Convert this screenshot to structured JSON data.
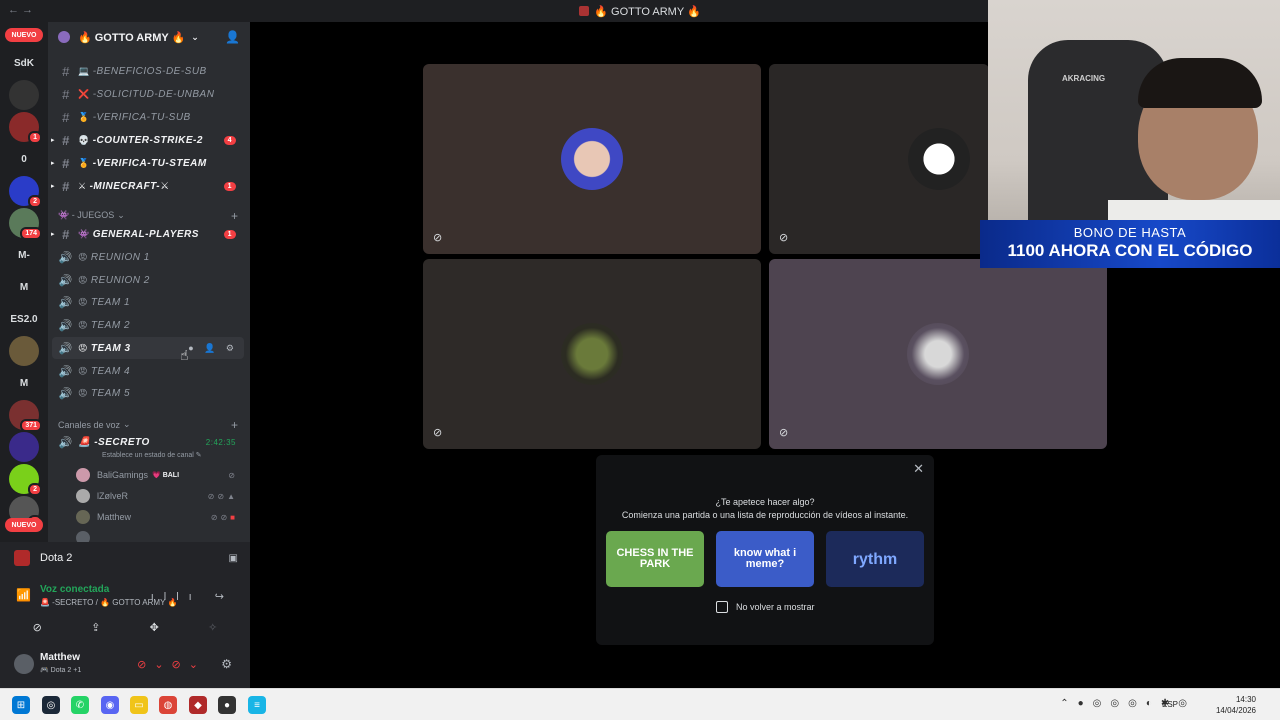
{
  "titlebar": {
    "title": "🔥 GOTTO ARMY 🔥",
    "nav": "←  →"
  },
  "rail": {
    "nuevo_top": "NUEVO",
    "nuevo_bottom": "NUEVO",
    "servers": [
      {
        "label": "SdK",
        "badge": ""
      },
      {
        "label": "",
        "badge": ""
      },
      {
        "label": "",
        "badge": "1"
      },
      {
        "label": "0",
        "badge": ""
      },
      {
        "label": "",
        "badge": "2"
      },
      {
        "label": "",
        "badge": "174"
      },
      {
        "label": "M-",
        "badge": ""
      },
      {
        "label": "M",
        "badge": ""
      },
      {
        "label": "ES2.0",
        "badge": ""
      },
      {
        "label": "",
        "badge": ""
      },
      {
        "label": "M",
        "badge": ""
      },
      {
        "label": "",
        "badge": "371"
      },
      {
        "label": "",
        "badge": ""
      },
      {
        "label": "",
        "badge": "2"
      },
      {
        "label": "",
        "badge": "2"
      }
    ]
  },
  "server": {
    "name": "🔥 GOTTO ARMY 🔥"
  },
  "channels": [
    {
      "icon": "hash",
      "emoji": "💻",
      "name": "-BENEFICIOS-DE-SUB",
      "unread": false,
      "badge": ""
    },
    {
      "icon": "hash",
      "emoji": "❌",
      "name": "-SOLICITUD-DE-UNBAN",
      "unread": false,
      "badge": ""
    },
    {
      "icon": "hash",
      "emoji": "🏅",
      "name": "-VERIFICA-TU-SUB",
      "unread": false,
      "badge": ""
    },
    {
      "icon": "hash",
      "emoji": "💀",
      "name": "-COUNTER-STRIKE-2",
      "unread": true,
      "badge": "4"
    },
    {
      "icon": "hash",
      "emoji": "🏅",
      "name": "-VERIFICA-TU-STEAM",
      "unread": true,
      "badge": ""
    },
    {
      "icon": "hash",
      "emoji": "⚔",
      "name": "-MINECRAFT-⚔",
      "unread": true,
      "badge": "1"
    }
  ],
  "category_juegos": "👾 - JUEGOS",
  "games": [
    {
      "icon": "hash",
      "emoji": "👾",
      "name": "GENERAL-PLAYERS",
      "unread": true,
      "badge": "1"
    },
    {
      "icon": "speaker",
      "emoji": "😡",
      "name": "REUNION 1",
      "unread": false,
      "badge": ""
    },
    {
      "icon": "speaker",
      "emoji": "😡",
      "name": "REUNION 2",
      "unread": false,
      "badge": ""
    },
    {
      "icon": "speaker",
      "emoji": "😡",
      "name": "TEAM 1",
      "unread": false,
      "badge": ""
    },
    {
      "icon": "speaker",
      "emoji": "😡",
      "name": "TEAM 2",
      "unread": false,
      "badge": ""
    },
    {
      "icon": "speaker",
      "emoji": "😡",
      "name": "TEAM 3",
      "unread": false,
      "badge": ""
    },
    {
      "icon": "speaker",
      "emoji": "😡",
      "name": "TEAM 4",
      "unread": false,
      "badge": ""
    },
    {
      "icon": "speaker",
      "emoji": "😡",
      "name": "TEAM 5",
      "unread": false,
      "badge": ""
    }
  ],
  "category_voice": "Canales de voz",
  "active_voice": {
    "name": "🚨 -SECRETO",
    "time": "2:42:35",
    "status": "Establece un estado de canal ✎"
  },
  "voice_users": [
    {
      "name": "BaliGamings",
      "tag": "💗 BALI",
      "icons": ""
    },
    {
      "name": "lZølveR",
      "tag": "",
      "icons": ""
    },
    {
      "name": "Matthew",
      "tag": "",
      "icons": ""
    },
    {
      "name": "",
      "tag": "",
      "icons": ""
    }
  ],
  "activity": {
    "game": "Dota 2"
  },
  "voice_status": {
    "connected": "Voz conectada",
    "channel": "🚨 -SECRETO / 🔥 GOTTO ARMY 🔥"
  },
  "user": {
    "name": "Matthew",
    "status": "🎮 Dota 2 +1"
  },
  "popup": {
    "question": "¿Te apetece hacer algo?",
    "subtitle": "Comienza una partida o una lista de reproducción de vídeos al instante.",
    "cards": [
      "CHESS IN THE PARK",
      "know what i meme?",
      "rythm"
    ],
    "checkbox_label": "No volver a mostrar"
  },
  "webcam": {
    "chair_brand": "AKRACING",
    "banner_line1": "BONO DE HASTA",
    "banner_line2": "1100 AHORA CON EL CÓDIGO"
  },
  "taskbar": {
    "lang": "ESP",
    "time": "14:30",
    "date": "14/04/2026"
  },
  "colors": {
    "accent": "#5865f2",
    "danger": "#f23f43",
    "online": "#23a55a",
    "sidebar": "#2b2d31"
  }
}
